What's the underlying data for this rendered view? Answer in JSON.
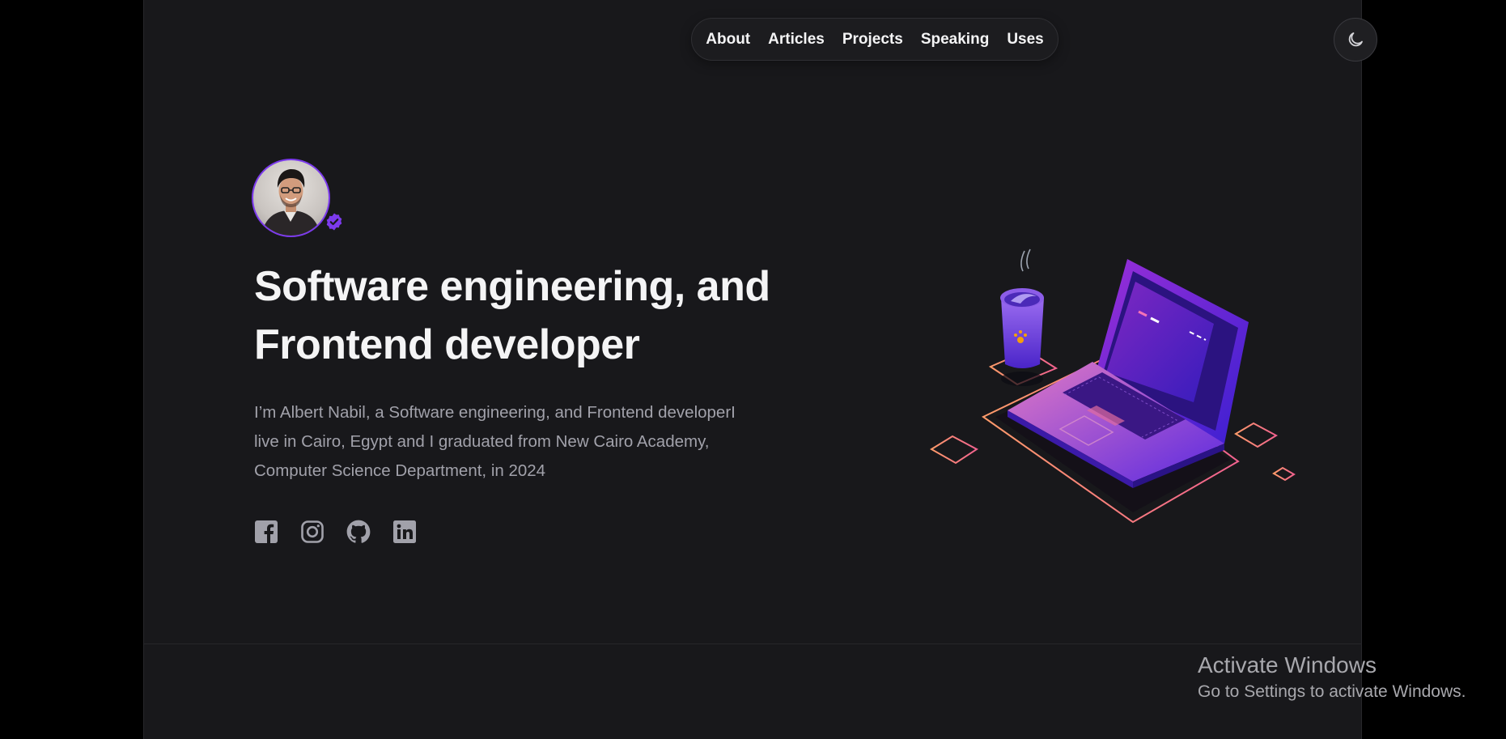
{
  "nav": {
    "items": [
      {
        "label": "About"
      },
      {
        "label": "Articles"
      },
      {
        "label": "Projects"
      },
      {
        "label": "Speaking"
      },
      {
        "label": "Uses"
      }
    ]
  },
  "theme_toggle": {
    "icon": "moon-icon"
  },
  "hero": {
    "avatar_badge_icon": "verified-badge-icon",
    "title_line1": "Software engineering, and",
    "title_line2": "Frontend developer",
    "bio_line1": "I’m Albert Nabil, a Software engineering, and Frontend developerI",
    "bio_line2": "live in Cairo, Egypt and I graduated from New Cairo Academy,",
    "bio_line3": "Computer Science Department, in 2024",
    "socials": [
      {
        "icon": "facebook-icon"
      },
      {
        "icon": "instagram-icon"
      },
      {
        "icon": "github-icon"
      },
      {
        "icon": "linkedin-icon"
      }
    ]
  },
  "watermark": {
    "title": "Activate Windows",
    "subtitle": "Go to Settings to activate Windows."
  },
  "colors": {
    "background": "#18181b",
    "accent": "#7c3aed",
    "text": "#f4f4f5",
    "muted": "#a1a1aa"
  }
}
